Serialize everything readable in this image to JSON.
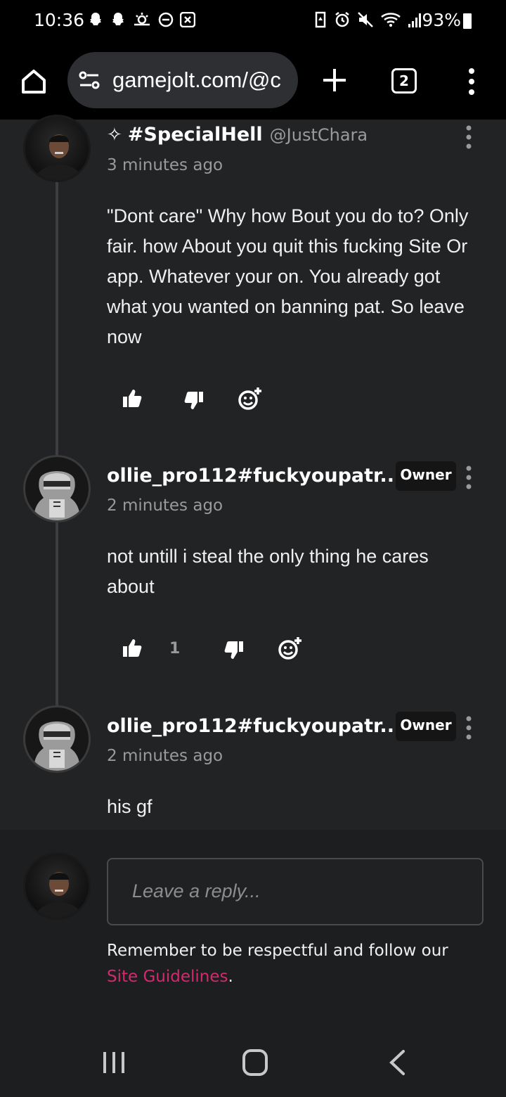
{
  "status_bar": {
    "time": "10:36",
    "battery": "93%",
    "left_icons": [
      "snapchat-icon",
      "snapchat-icon",
      "weather-icon",
      "do-not-disturb-icon",
      "app-notification-icon"
    ],
    "right_icons": [
      "recycle-icon",
      "alarm-icon",
      "mute-icon",
      "wifi-icon",
      "signal-icon"
    ]
  },
  "browser": {
    "url": "gamejolt.com/@c",
    "tab_count": "2"
  },
  "comments": [
    {
      "star": "✧",
      "name": "#SpecialHell",
      "handle": "@JustChara",
      "time": "3 minutes ago",
      "body": "\"Dont care\" Why how Bout you do to? Only fair. how About you quit this fucking Site Or app. Whatever your on. You already got what you wanted on banning pat. So leave now",
      "likes": ""
    },
    {
      "name": "ollie_pro112#fuckyoupatr...",
      "badge": "Owner",
      "time": "2 minutes ago",
      "body": "not untill i steal the only thing he cares about",
      "likes": "1"
    },
    {
      "name": "ollie_pro112#fuckyoupatr...",
      "badge": "Owner",
      "time": "2 minutes ago",
      "body": "his gf"
    }
  ],
  "reply": {
    "placeholder": "Leave a reply...",
    "guidelines_text": "Remember to be respectful and follow our ",
    "guidelines_link": "Site Guidelines",
    "guidelines_end": "."
  },
  "colors": {
    "background": "#222325",
    "link": "#d22a6c",
    "muted": "#9a9a9a"
  }
}
